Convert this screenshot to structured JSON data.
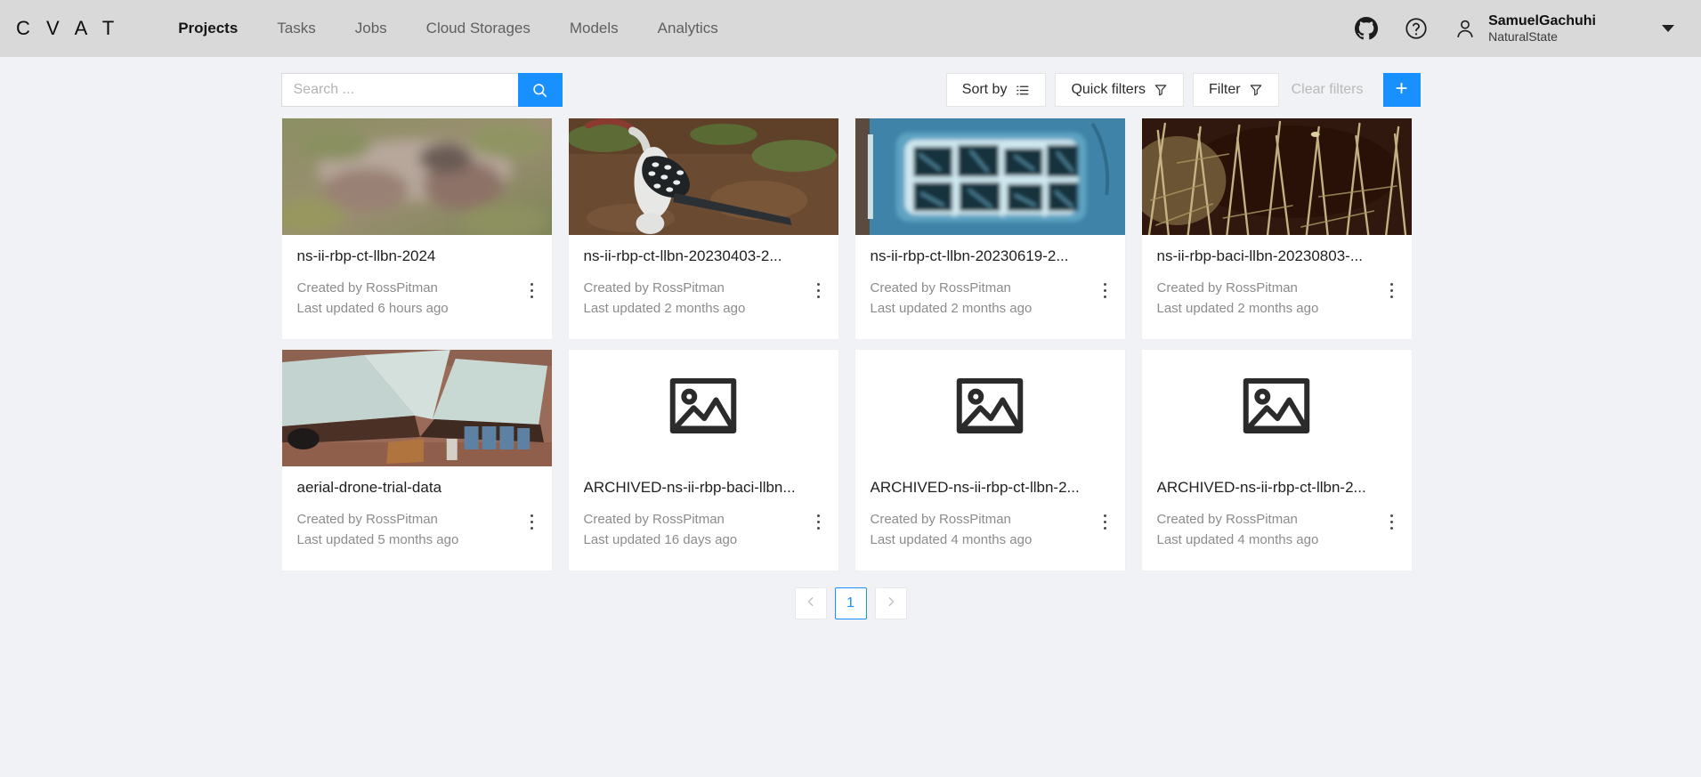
{
  "header": {
    "logo": "C V A T",
    "nav": [
      {
        "label": "Projects",
        "active": true
      },
      {
        "label": "Tasks",
        "active": false
      },
      {
        "label": "Jobs",
        "active": false
      },
      {
        "label": "Cloud Storages",
        "active": false
      },
      {
        "label": "Models",
        "active": false
      },
      {
        "label": "Analytics",
        "active": false
      }
    ],
    "github_icon": "github-icon",
    "help_icon": "question-circle-icon",
    "avatar_icon": "user-icon",
    "user_name": "SamuelGachuhi",
    "user_org": "NaturalState",
    "caret_icon": "chevron-down-icon"
  },
  "toolbar": {
    "search_placeholder": "Search ...",
    "search_value": "",
    "search_icon": "search-icon",
    "sort_by_label": "Sort by",
    "sort_by_icon": "sort-list-icon",
    "quick_filters_label": "Quick filters",
    "quick_filters_icon": "filter-icon",
    "filter_label": "Filter",
    "filter_icon": "filter-icon",
    "clear_filters_label": "Clear filters",
    "create_label": "+"
  },
  "accent_color": "#1890ff",
  "projects": [
    {
      "title": "ns-ii-rbp-ct-llbn-2024",
      "created_by": "Created by RossPitman",
      "updated": "Last updated 6 hours ago",
      "thumb": "camera-trap-blurred-animal",
      "has_image": true
    },
    {
      "title": "ns-ii-rbp-ct-llbn-20230403-2...",
      "created_by": "Created by RossPitman",
      "updated": "Last updated 2 months ago",
      "thumb": "hornbill-bird-on-soil",
      "has_image": true
    },
    {
      "title": "ns-ii-rbp-ct-llbn-20230619-2...",
      "created_by": "Created by RossPitman",
      "updated": "Last updated 2 months ago",
      "thumb": "blue-thermal-camera-trap",
      "has_image": true
    },
    {
      "title": "ns-ii-rbp-baci-llbn-20230803-...",
      "created_by": "Created by RossPitman",
      "updated": "Last updated 2 months ago",
      "thumb": "dry-grass-reeds",
      "has_image": true
    },
    {
      "title": "aerial-drone-trial-data",
      "created_by": "Created by RossPitman",
      "updated": "Last updated 5 months ago",
      "thumb": "aerial-rooftops",
      "has_image": true
    },
    {
      "title": "ARCHIVED-ns-ii-rbp-baci-llbn...",
      "created_by": "Created by RossPitman",
      "updated": "Last updated 16 days ago",
      "thumb": "image-placeholder-icon",
      "has_image": false
    },
    {
      "title": "ARCHIVED-ns-ii-rbp-ct-llbn-2...",
      "created_by": "Created by RossPitman",
      "updated": "Last updated 4 months ago",
      "thumb": "image-placeholder-icon",
      "has_image": false
    },
    {
      "title": "ARCHIVED-ns-ii-rbp-ct-llbn-2...",
      "created_by": "Created by RossPitman",
      "updated": "Last updated 4 months ago",
      "thumb": "image-placeholder-icon",
      "has_image": false
    }
  ],
  "pagination": {
    "prev_icon": "chevron-left-icon",
    "next_icon": "chevron-right-icon",
    "pages": [
      "1"
    ],
    "current": "1"
  }
}
